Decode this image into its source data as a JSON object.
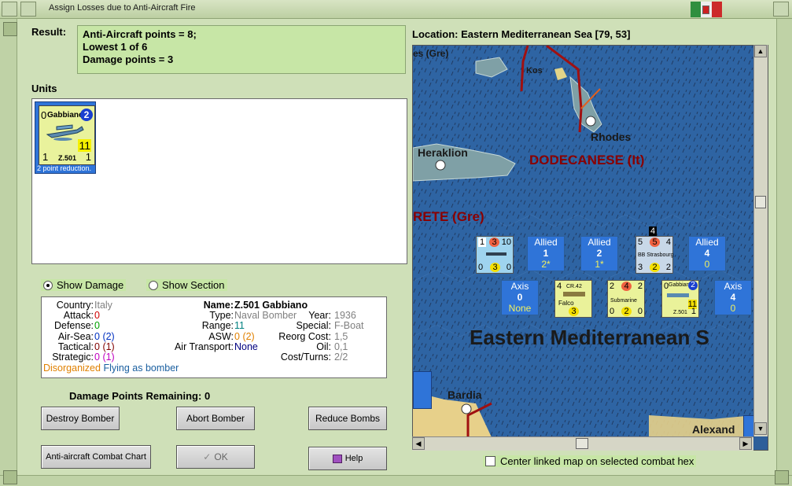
{
  "window": {
    "title": "Assign Losses due to Anti-Aircraft Fire"
  },
  "result": {
    "label": "Result:",
    "lines": [
      "Anti-Aircraft points = 8;",
      "Lowest 1 of 6",
      "Damage points = 3"
    ]
  },
  "units": {
    "label": "Units",
    "selected_unit": {
      "name": "Gabbiano",
      "left_value": "0",
      "circle_value": "2",
      "big_value": "11",
      "bottom_left": "1",
      "bottom_right": "1",
      "model": "Z.501",
      "note": "2 point reduction."
    }
  },
  "radio": {
    "show_damage": "Show Damage",
    "show_section": "Show Section"
  },
  "details": {
    "country_label": "Country:",
    "country": "Italy",
    "attack_label": "Attack:",
    "attack": "0",
    "defense_label": "Defense:",
    "defense": "0",
    "air_sea_label": "Air-Sea:",
    "air_sea": "0",
    "air_sea_paren": "(2)",
    "tactical_label": "Tactical:",
    "tactical": "0",
    "tactical_paren": "(1)",
    "strategic_label": "Strategic:",
    "strategic": "0",
    "strategic_paren": "(1)",
    "name_label": "Name:",
    "name": "Z.501 Gabbiano",
    "type_label": "Type:",
    "type": "Naval Bomber",
    "year_label": "Year:",
    "year": "1936",
    "range_label": "Range:",
    "range": "11",
    "special_label": "Special:",
    "special": "F-Boat",
    "asw_label": "ASW:",
    "asw": "0",
    "asw_paren": "(2)",
    "reorg_label": "Reorg Cost:",
    "reorg": "1,5",
    "air_transport_label": "Air Transport:",
    "air_transport": "None",
    "oil_label": "Oil:",
    "oil": "0,1",
    "cost_label": "Cost/Turns:",
    "cost": "2/2",
    "status_disorganized": "Disorganized",
    "status_flying": "Flying as bomber"
  },
  "damage_remaining": {
    "label": "Damage Points Remaining:",
    "value": "0"
  },
  "buttons": {
    "destroy": "Destroy Bomber",
    "abort": "Abort Bomber",
    "reduce": "Reduce Bombs",
    "chart": "Anti-aircraft Combat Chart",
    "ok": "OK",
    "help": "Help"
  },
  "location": {
    "label": "Location:",
    "value": "Eastern Mediterranean Sea [79, 53]"
  },
  "map": {
    "places": {
      "gre_top": "es (Gre)",
      "kos": "Kos",
      "rhodes": "Rhodes",
      "heraklion": "Heraklion",
      "dodecanese": "DODECANESE (It)",
      "crete": "RETE (Gre)",
      "sea": "Eastern Mediterranean S",
      "bardia": "Bardia",
      "alexandria": "Alexand"
    },
    "allied": [
      {
        "label": "Allied",
        "num": "1",
        "sub": "2*"
      },
      {
        "label": "Allied",
        "num": "2",
        "sub": "1*"
      },
      {
        "label": "Allied",
        "num": "4",
        "sub": "0"
      }
    ],
    "axis": [
      {
        "label": "Axis",
        "num": "0",
        "sub": "None"
      },
      {
        "label": "Axis",
        "num": "4",
        "sub": "0"
      }
    ],
    "counters": {
      "ship1": {
        "a": "1",
        "b": "3",
        "c": "10",
        "d": "0",
        "e": "3",
        "f": "0"
      },
      "strasbourg": {
        "top": "4",
        "a": "5",
        "b": "5",
        "c": "4",
        "name": "BB Strasbourg",
        "d": "3",
        "e": "2",
        "f": "2"
      },
      "falco": {
        "a": "4",
        "name": "CR.42",
        "sub": "Falco",
        "b": "3"
      },
      "submarine": {
        "a": "2",
        "b": "4",
        "c": "2",
        "name": "Submarine",
        "d": "0",
        "e": "2",
        "f": "0"
      },
      "gabbiano": {
        "a": "0",
        "name": "Gabbiano",
        "circle": "2",
        "big": "11",
        "model": "Z.501",
        "b": "1"
      }
    }
  },
  "center_checkbox": "Center linked map on selected combat hex"
}
